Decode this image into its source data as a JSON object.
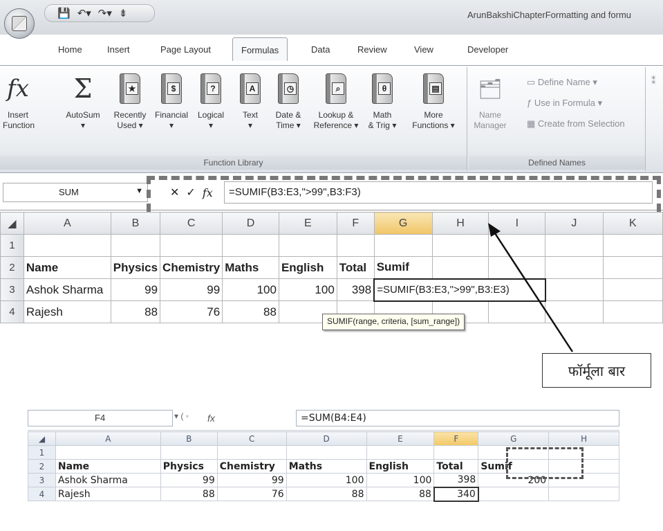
{
  "window": {
    "title": "ArunBakshiChapterFormatting and formu",
    "qat_icons": [
      "save-icon",
      "undo-icon",
      "redo-icon",
      "customize-icon"
    ]
  },
  "ribbon_tabs": [
    "Home",
    "Insert",
    "Page Layout",
    "Formulas",
    "Data",
    "Review",
    "View",
    "Developer"
  ],
  "active_tab": "Formulas",
  "function_library": {
    "label": "Function Library",
    "buttons": [
      {
        "glyph": "fx",
        "line1": "Insert",
        "line2": "Function"
      },
      {
        "glyph": "Σ",
        "line1": "AutoSum",
        "line2": "▾"
      },
      {
        "glyph": "★",
        "line1": "Recently",
        "line2": "Used ▾"
      },
      {
        "glyph": "$",
        "line1": "Financial",
        "line2": "▾"
      },
      {
        "glyph": "?",
        "line1": "Logical",
        "line2": "▾"
      },
      {
        "glyph": "A",
        "line1": "Text",
        "line2": "▾"
      },
      {
        "glyph": "◷",
        "line1": "Date &",
        "line2": "Time ▾"
      },
      {
        "glyph": "⌕",
        "line1": "Lookup &",
        "line2": "Reference ▾"
      },
      {
        "glyph": "θ",
        "line1": "Math",
        "line2": "& Trig ▾"
      },
      {
        "glyph": "▤",
        "line1": "More",
        "line2": "Functions ▾"
      }
    ]
  },
  "defined_names": {
    "label": "Defined Names",
    "name_manager_line1": "Name",
    "name_manager_line2": "Manager",
    "define_name": "Define Name ▾",
    "use_in_formula": "Use in Formula ▾",
    "create_from_selection": "Create from Selection"
  },
  "formula_bar_top": {
    "name_box": "SUM",
    "cancel": "✕",
    "enter": "✓",
    "fx": "fx",
    "formula": "=SUMIF(B3:E3,\">99\",B3:F3)"
  },
  "grid_top": {
    "columns": [
      "A",
      "B",
      "C",
      "D",
      "E",
      "F",
      "G",
      "H",
      "I",
      "J",
      "K"
    ],
    "rows": [
      [
        "1",
        "",
        "",
        "",
        "",
        "",
        "",
        "",
        "",
        "",
        "",
        ""
      ],
      [
        "2",
        "Name",
        "Physics",
        "Chemistry",
        "Maths",
        "English",
        "Total",
        "Sumif",
        "",
        "",
        "",
        ""
      ],
      [
        "3",
        "Ashok Sharma",
        "99",
        "99",
        "100",
        "100",
        "398",
        "=SUMIF(B3:E3,\">99\",B3:E3)",
        "",
        "",
        "",
        ""
      ],
      [
        "4",
        "Rajesh",
        "88",
        "76",
        "88",
        "",
        "",
        "",
        "",
        "",
        "",
        ""
      ]
    ],
    "tooltip": "SUMIF(range, criteria, [sum_range])"
  },
  "annotation_label": "फॉर्मूला बार",
  "formula_bar_bottom": {
    "name_box": "F4",
    "fx": "fx",
    "formula": "=SUM(B4:E4)"
  },
  "grid_bottom": {
    "columns": [
      "A",
      "B",
      "C",
      "D",
      "E",
      "F",
      "G",
      "H"
    ],
    "rows": [
      [
        "1",
        "",
        "",
        "",
        "",
        "",
        "",
        "",
        ""
      ],
      [
        "2",
        "Name",
        "Physics",
        "Chemistry",
        "Maths",
        "English",
        "Total",
        "Sumif",
        ""
      ],
      [
        "3",
        "Ashok Sharma",
        "99",
        "99",
        "100",
        "100",
        "398",
        "200",
        ""
      ],
      [
        "4",
        "Rajesh",
        "88",
        "76",
        "88",
        "88",
        "340",
        "",
        ""
      ]
    ]
  },
  "colors": {
    "ribbon_bg": "#eceff2",
    "selected_header": "#f1c567",
    "dashed_highlight": "#777777"
  }
}
